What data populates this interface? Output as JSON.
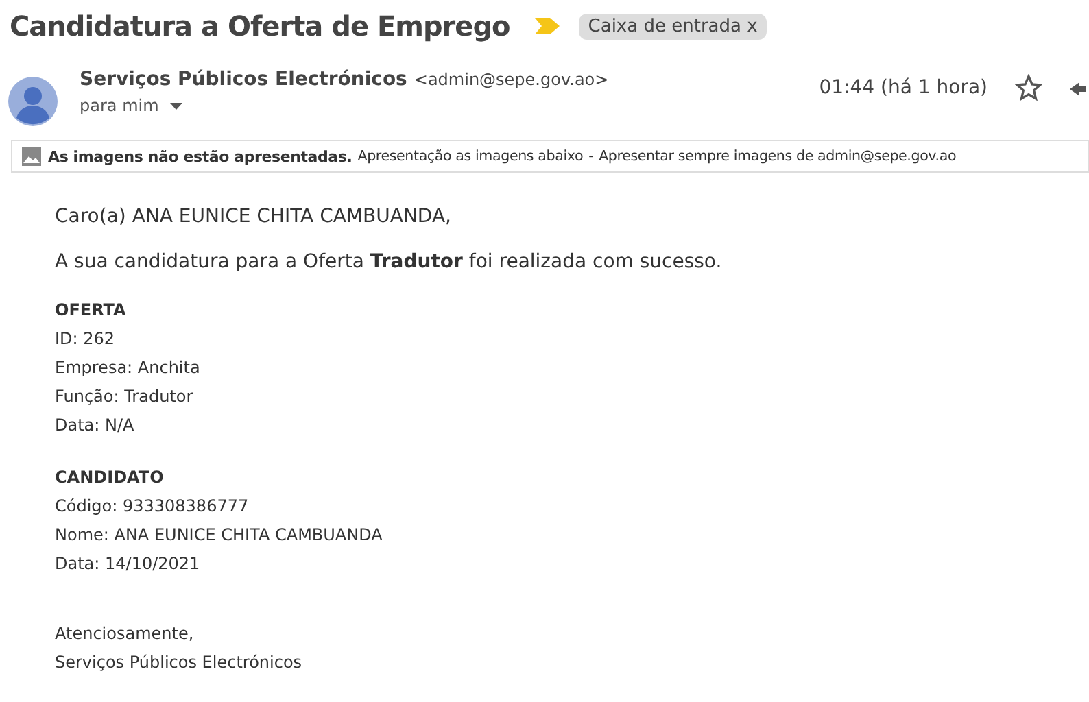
{
  "subject": "Candidatura a Oferta de Emprego",
  "label": {
    "text": "Caixa de entrada x"
  },
  "sender": {
    "name": "Serviços Públicos Electrónicos",
    "email": "<admin@sepe.gov.ao>",
    "to": "para mim",
    "time": "01:44 (há 1 hora)",
    "starred": false
  },
  "images_notice": {
    "bold": "As imagens não estão apresentadas.",
    "show_below": "Apresentação as imagens abaixo",
    "separator": "-",
    "always_show": "Apresentar sempre imagens de admin@sepe.gov.ao"
  },
  "body": {
    "greeting": "Caro(a) ANA EUNICE CHITA CAMBUANDA,",
    "message": "A sua candidatura para a Oferta **Tradutor** foi realizada com sucesso.",
    "sections": [
      {
        "heading": "OFERTA",
        "lines": [
          "ID: 262",
          "Empresa: Anchita",
          "Função: Tradutor",
          "Data: N/A"
        ]
      },
      {
        "heading": "CANDIDATO",
        "lines": [
          "Código: 933308386777",
          "Nome: ANA EUNICE CHITA CAMBUANDA",
          "Data: 14/10/2021"
        ]
      }
    ],
    "closing": [
      "Atenciosamente,",
      "Serviços Públicos Electrónicos"
    ]
  }
}
